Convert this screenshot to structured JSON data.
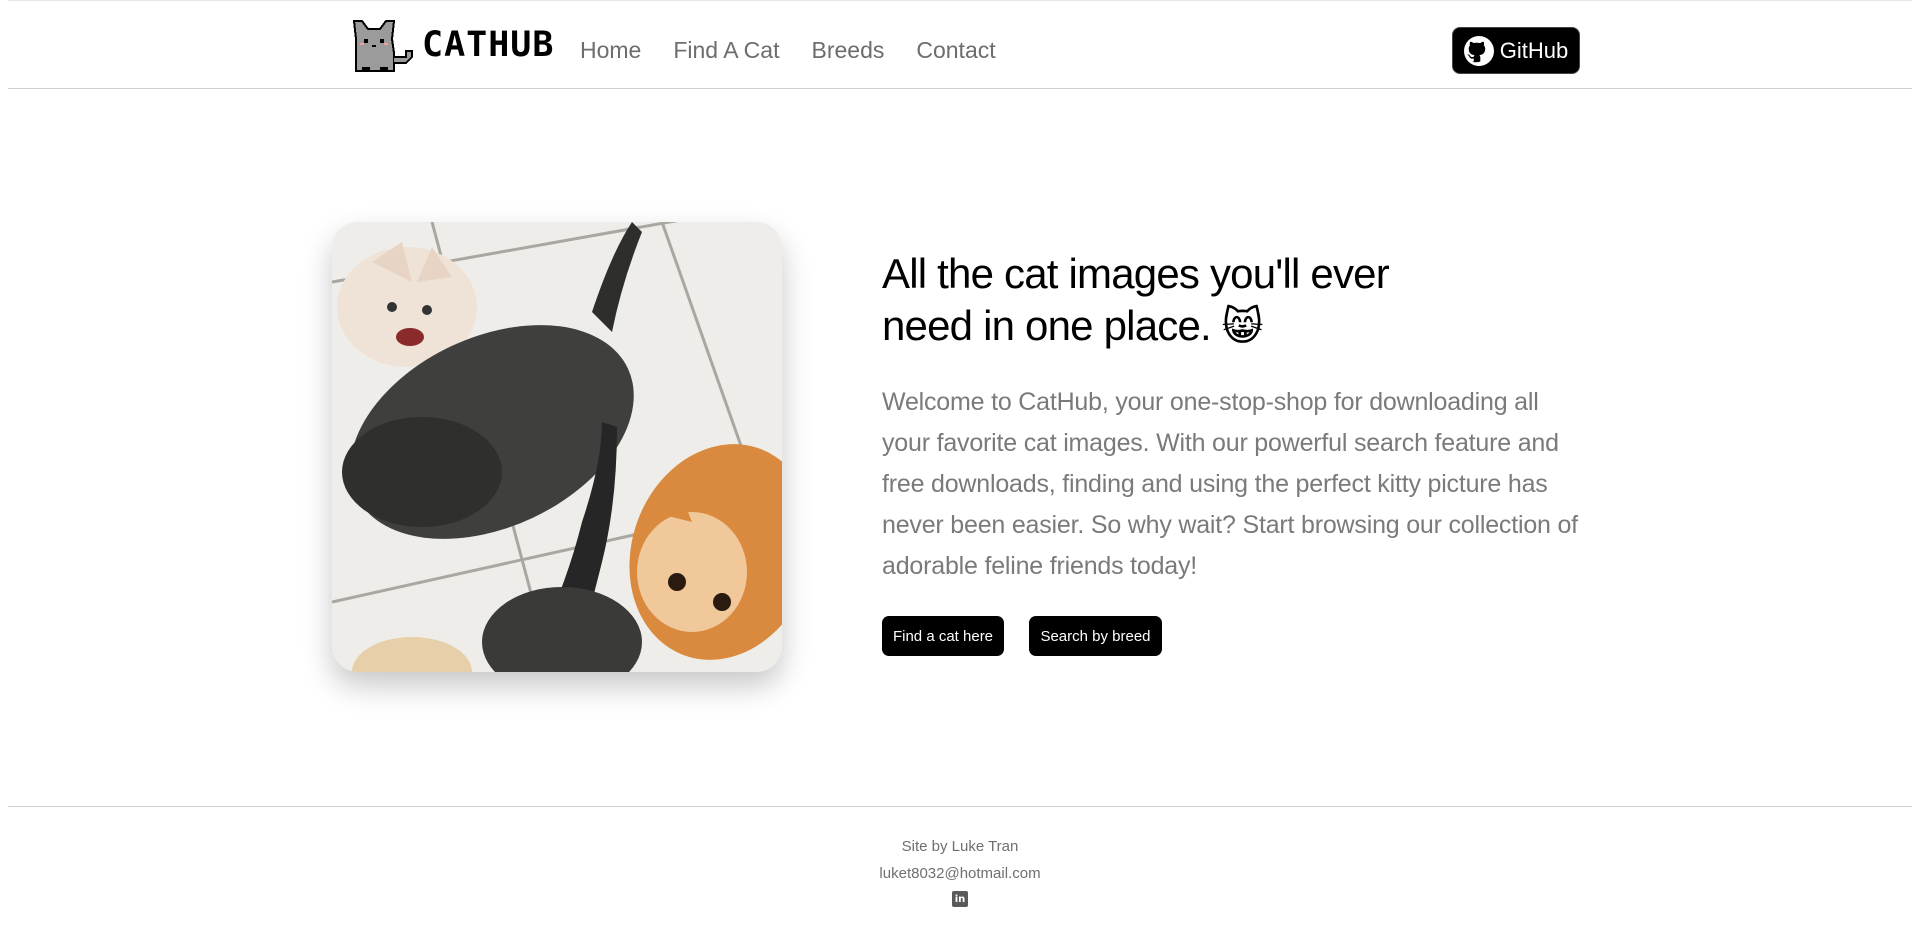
{
  "header": {
    "logo_text": "CATHUB",
    "nav": [
      {
        "label": "Home"
      },
      {
        "label": "Find A Cat"
      },
      {
        "label": "Breeds"
      },
      {
        "label": "Contact"
      }
    ],
    "github_label": "GitHub"
  },
  "hero": {
    "title": "All the cat images you'll ever need in one place.",
    "title_emoji": "😸",
    "description": "Welcome to CatHub, your one-stop-shop for downloading all your favorite cat images. With our powerful search feature and free downloads, finding and using the perfect kitty picture has never been easier. So why wait? Start browsing our collection of adorable feline friends today!",
    "buttons": {
      "find_label": "Find a cat here",
      "breed_label": "Search by breed"
    }
  },
  "footer": {
    "credit": "Site by Luke Tran",
    "email": "luket8032@hotmail.com",
    "linkedin_icon_text": "in"
  },
  "icons": {
    "logo": "pixel-cat-icon",
    "github": "github-icon",
    "linkedin": "linkedin-icon"
  },
  "colors": {
    "button_bg": "#000000",
    "nav_text": "#6d6d6d",
    "body_text": "#7a7a7a"
  }
}
